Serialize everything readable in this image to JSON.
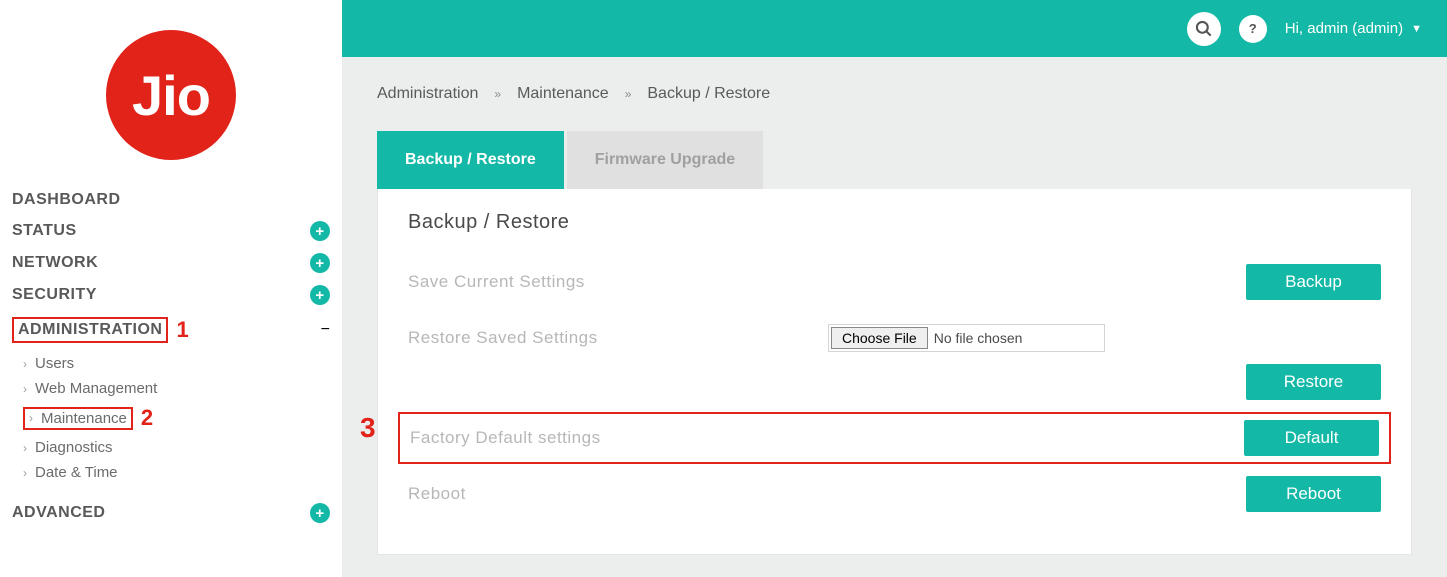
{
  "logo_text": "Jio",
  "sidebar": {
    "items": [
      {
        "label": "DASHBOARD",
        "expander": null
      },
      {
        "label": "STATUS",
        "expander": "+"
      },
      {
        "label": "NETWORK",
        "expander": "+"
      },
      {
        "label": "SECURITY",
        "expander": "+"
      },
      {
        "label": "ADMINISTRATION",
        "expander": "−"
      },
      {
        "label": "ADVANCED",
        "expander": "+"
      }
    ],
    "admin_sub": [
      {
        "label": "Users"
      },
      {
        "label": "Web Management"
      },
      {
        "label": "Maintenance"
      },
      {
        "label": "Diagnostics"
      },
      {
        "label": "Date & Time"
      }
    ]
  },
  "annotations": {
    "n1": "1",
    "n2": "2",
    "n3": "3"
  },
  "topbar": {
    "help": "?",
    "greeting": "Hi, admin (admin)"
  },
  "breadcrumb": {
    "a": "Administration",
    "b": "Maintenance",
    "c": "Backup / Restore"
  },
  "tabs": {
    "t1": "Backup / Restore",
    "t2": "Firmware Upgrade"
  },
  "panel": {
    "title": "Backup / Restore",
    "save_label": "Save Current Settings",
    "backup_btn": "Backup",
    "restore_label": "Restore Saved Settings",
    "choose_file_btn": "Choose File",
    "no_file": "No file chosen",
    "restore_btn": "Restore",
    "factory_label": "Factory Default settings",
    "default_btn": "Default",
    "reboot_label": "Reboot",
    "reboot_btn": "Reboot"
  }
}
